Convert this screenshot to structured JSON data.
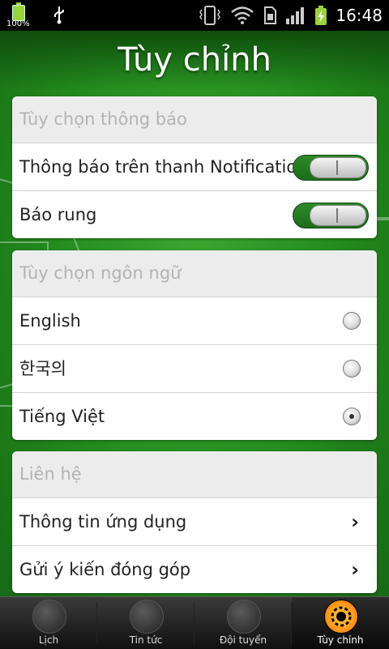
{
  "status_bar": {
    "battery_left_percent": "100%",
    "time": "16:48"
  },
  "header": {
    "title": "Tùy chỉnh"
  },
  "notification_section": {
    "title": "Tùy chọn thông báo",
    "items": [
      {
        "label": "Thông báo trên thanh Notification",
        "enabled": true
      },
      {
        "label": "Báo rung",
        "enabled": true
      }
    ]
  },
  "language_section": {
    "title": "Tùy chọn ngôn ngữ",
    "options": [
      {
        "label": "English",
        "selected": false
      },
      {
        "label": "한국의",
        "selected": false
      },
      {
        "label": "Tiếng Việt",
        "selected": true
      }
    ]
  },
  "contact_section": {
    "title": "Liên hệ",
    "items": [
      {
        "label": "Thông tin ứng dụng"
      },
      {
        "label": "Gửi ý kiến đóng góp"
      }
    ]
  },
  "bottom_nav": {
    "tabs": [
      {
        "label": "Lịch",
        "active": false
      },
      {
        "label": "Tin tức",
        "active": false
      },
      {
        "label": "Đội tuyển",
        "active": false
      },
      {
        "label": "Tùy chỉnh",
        "active": true
      }
    ]
  },
  "colors": {
    "field_green": "#248d1e",
    "toggle_green": "#2e8a2a",
    "active_tab_orange": "#ff8b14"
  }
}
